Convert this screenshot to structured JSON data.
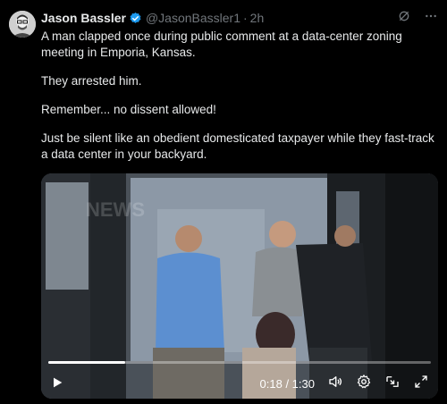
{
  "tweet": {
    "author_name": "Jason Bassler",
    "author_handle": "@JasonBassler1",
    "separator": "·",
    "time": "2h",
    "paragraphs": [
      "A man clapped once during public comment at a data-center zoning meeting in Emporia, Kansas.",
      "They arrested him.",
      "Remember... no dissent allowed!",
      "Just be silent like an obedient domesticated taxpayer while they fast-track a data center in your backyard."
    ]
  },
  "video": {
    "timecode": "0:18 / 1:30",
    "progress_fraction": 0.2,
    "watermark": "NEWS"
  },
  "colors": {
    "background": "#000000",
    "text": "#e7e9ea",
    "muted": "#71767b",
    "verified": "#1d9bf0"
  },
  "icons": [
    "verified-badge-icon",
    "grok-icon",
    "more-icon",
    "play-icon",
    "volume-icon",
    "settings-icon",
    "pip-icon",
    "fullscreen-icon"
  ]
}
